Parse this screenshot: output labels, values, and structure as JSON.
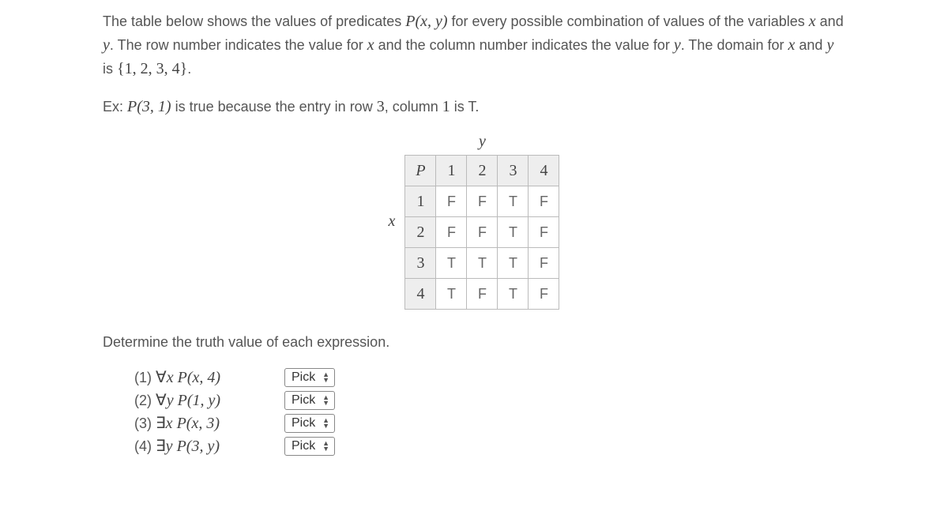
{
  "intro": {
    "p1a": "The table below shows the values of predicates ",
    "p1_pred": "P(x, y)",
    "p1b": " for every possible combination of values of the variables ",
    "p1_x": "x",
    "p1c": " and ",
    "p1_y": "y",
    "p1d": ". The row number indicates the value for ",
    "p1e": " and the column number indicates the value for ",
    "p1f": ". The domain for ",
    "p1g": " is ",
    "p1_set": "{1, 2, 3, 4}",
    "p1h": "."
  },
  "example": {
    "lead": "Ex: ",
    "pred": "P(3, 1)",
    "mid": " is true because the entry in row ",
    "row": "3",
    "mid2": ", column ",
    "col": "1",
    "tail": " is T."
  },
  "table": {
    "xlabel": "x",
    "ylabel": "y",
    "corner": "P",
    "cols": [
      "1",
      "2",
      "3",
      "4"
    ],
    "rows": [
      "1",
      "2",
      "3",
      "4"
    ],
    "cells": [
      [
        "F",
        "F",
        "T",
        "F"
      ],
      [
        "F",
        "F",
        "T",
        "F"
      ],
      [
        "T",
        "T",
        "T",
        "F"
      ],
      [
        "T",
        "F",
        "T",
        "F"
      ]
    ]
  },
  "determine_label": "Determine the truth value of each expression.",
  "questions": [
    {
      "num": "(1)",
      "q": "∀",
      "var": "x",
      "pred": "P(x, 4)"
    },
    {
      "num": "(2)",
      "q": "∀",
      "var": "y",
      "pred": "P(1, y)"
    },
    {
      "num": "(3)",
      "q": "∃",
      "var": "x",
      "pred": "P(x, 3)"
    },
    {
      "num": "(4)",
      "q": "∃",
      "var": "y",
      "pred": "P(3, y)"
    }
  ],
  "picker_label": "Pick"
}
